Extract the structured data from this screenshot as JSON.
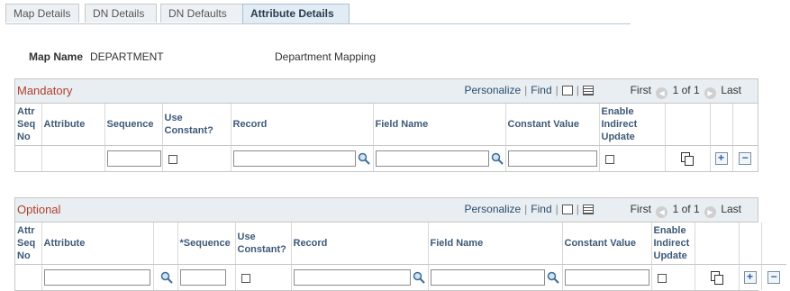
{
  "tabs": [
    {
      "label": "Map Details",
      "active": false
    },
    {
      "label": "DN Details",
      "active": false
    },
    {
      "label": "DN Defaults",
      "active": false
    },
    {
      "label": "Attribute Details",
      "active": true
    }
  ],
  "map": {
    "name_label": "Map Name",
    "name_value": "DEPARTMENT",
    "description": "Department Mapping"
  },
  "mandatory": {
    "title": "Mandatory",
    "personalize": "Personalize",
    "find": "Find",
    "separator": "|",
    "first": "First",
    "range": "1 of 1",
    "last": "Last",
    "columns": {
      "seq_no": "Attr Seq No",
      "attribute": "Attribute",
      "sequence": "Sequence",
      "use_constant": "Use Constant?",
      "record": "Record",
      "field_name": "Field Name",
      "constant_value": "Constant Value",
      "enable_indirect": "Enable Indirect Update"
    },
    "row": {
      "seq_no": "",
      "attribute": "",
      "sequence": "",
      "record": "",
      "field_name": "",
      "constant_value": ""
    }
  },
  "optional": {
    "title": "Optional",
    "personalize": "Personalize",
    "find": "Find",
    "separator": "|",
    "first": "First",
    "range": "1 of 1",
    "last": "Last",
    "columns": {
      "seq_no": "Attr Seq No",
      "attribute": "Attribute",
      "sequence": "*Sequence",
      "use_constant": "Use Constant?",
      "record": "Record",
      "field_name": "Field Name",
      "constant_value": "Constant Value",
      "enable_indirect": "Enable Indirect Update"
    },
    "row": {
      "seq_no": "",
      "attribute": "",
      "sequence": "",
      "record": "",
      "field_name": "",
      "constant_value": ""
    }
  },
  "colors": {
    "grid_title": "#b23f2c",
    "link": "#2a4c6e",
    "header_text": "#3d5a78",
    "grid_band": "#e9eef2"
  },
  "icons": [
    "lookup-icon",
    "view-all-icon",
    "download-icon",
    "previous-icon",
    "next-icon",
    "copy-row-icon",
    "add-row-icon",
    "delete-row-icon"
  ]
}
